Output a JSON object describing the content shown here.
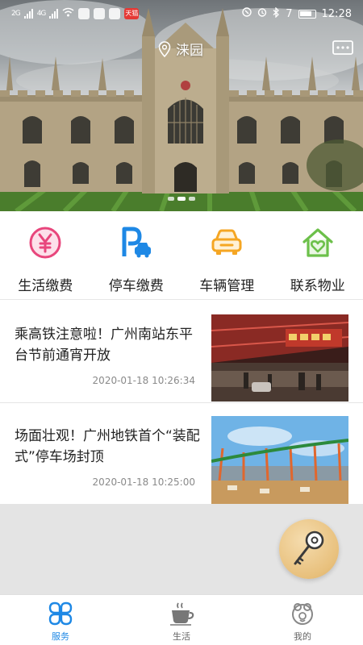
{
  "status_bar": {
    "network_left": "2G",
    "network_right": "4G",
    "app_badge": "天猫",
    "battery_text": "7",
    "time": "12:28"
  },
  "header": {
    "location": "涞园",
    "location_icon": "location-pin-icon",
    "message_icon": "message-icon"
  },
  "banner": {
    "slide_count": 3,
    "active_slide": 1
  },
  "services": [
    {
      "label": "生活缴费",
      "icon": "yuan-icon",
      "color": "#e8467c"
    },
    {
      "label": "停车缴费",
      "icon": "parking-car-icon",
      "color": "#1e88e5"
    },
    {
      "label": "车辆管理",
      "icon": "car-icon",
      "color": "#f5a623"
    },
    {
      "label": "联系物业",
      "icon": "house-heart-icon",
      "color": "#6cc04a"
    }
  ],
  "news": [
    {
      "title": "乘高铁注意啦！广州南站东平台节前通宵开放",
      "time": "2020-01-18 10:26:34"
    },
    {
      "title": "场面壮观！广州地铁首个“装配式”停车场封顶",
      "time": "2020-01-18 10:25:00"
    }
  ],
  "fab": {
    "icon": "key-icon"
  },
  "tabs": [
    {
      "label": "服务",
      "icon": "clover-icon",
      "active": true
    },
    {
      "label": "生活",
      "icon": "coffee-cup-icon",
      "active": false
    },
    {
      "label": "我的",
      "icon": "profile-icon",
      "active": false
    }
  ],
  "colors": {
    "accent": "#1e88e5",
    "time_text": "#8a8a8a",
    "panel": "#e4e4e4"
  }
}
